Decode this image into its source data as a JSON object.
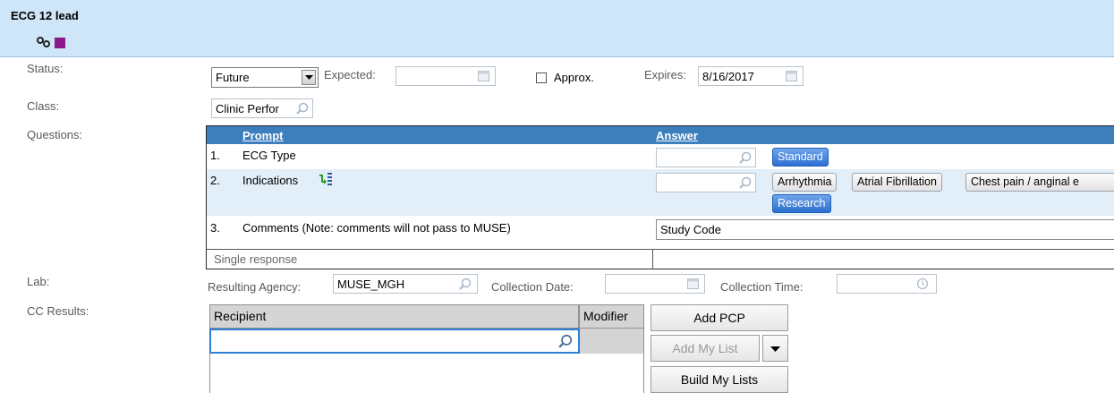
{
  "header": {
    "title": "ECG 12 lead"
  },
  "labels": {
    "status": "Status:",
    "class": "Class:",
    "questions": "Questions:",
    "lab": "Lab:",
    "cc_results": "CC Results:"
  },
  "status": {
    "value": "Future",
    "expected_label": "Expected:",
    "expected_value": "",
    "approx_label": "Approx.",
    "approx_checked": false,
    "expires_label": "Expires:",
    "expires_value": "8/16/2017"
  },
  "class": {
    "value": "Clinic Perfor"
  },
  "questions": {
    "prompt_header": "Prompt",
    "answer_header": "Answer",
    "rows": [
      {
        "num": "1.",
        "prompt": "ECG Type",
        "answer_value": "",
        "tokens": [
          "Standard"
        ]
      },
      {
        "num": "2.",
        "prompt": "Indications",
        "answer_value": "",
        "tokens": [
          "Arrhythmia",
          "Atrial Fibrillation",
          "Chest pain / anginal e",
          "Research"
        ]
      },
      {
        "num": "3.",
        "prompt": "Comments (Note: comments will not pass to MUSE)",
        "answer_value": "Study Code"
      }
    ],
    "footer_text": "Single response"
  },
  "lab": {
    "resulting_agency_label": "Resulting Agency:",
    "resulting_agency_value": "MUSE_MGH",
    "collection_date_label": "Collection Date:",
    "collection_date_value": "",
    "collection_time_label": "Collection Time:",
    "collection_time_value": ""
  },
  "cc_results": {
    "recipient_header": "Recipient",
    "modifier_header": "Modifier",
    "recipient_value": "",
    "add_pcp": "Add PCP",
    "add_my_list": "Add My List",
    "build_my_lists": "Build My Lists"
  },
  "colors": {
    "header_bg": "#cfe5f8",
    "table_header": "#3d7ebc",
    "token_blue": "#2c6fd1",
    "square_icon": "#8a1a8a"
  }
}
